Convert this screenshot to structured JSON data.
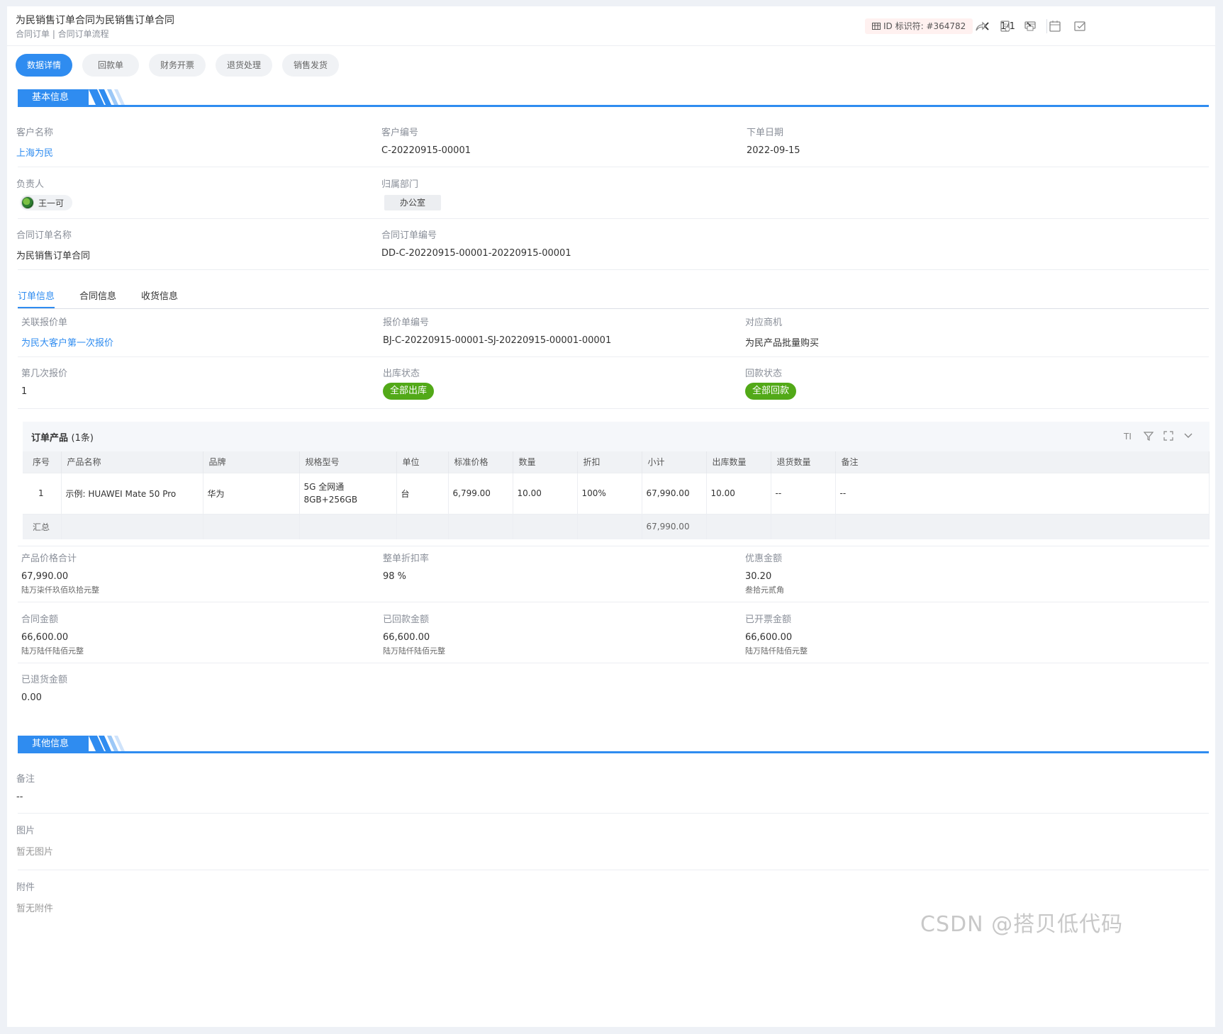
{
  "header": {
    "title": "为民销售订单合同为民销售订单合同",
    "subtitle": "合同订单 | 合同订单流程",
    "id_badge": "ID 标识符: #364782",
    "pager": "1/1"
  },
  "tabs": [
    "数据详情",
    "回款单",
    "财务开票",
    "退货处理",
    "销售发货"
  ],
  "basic": {
    "section_title": "基本信息",
    "customer_name_label": "客户名称",
    "customer_name": "上海为民",
    "customer_no_label": "客户编号",
    "customer_no": "C-20220915-00001",
    "order_date_label": "下单日期",
    "order_date": "2022-09-15",
    "owner_label": "负责人",
    "owner": "王一可",
    "dept_label": "归属部门",
    "dept": "办公室",
    "contract_name_label": "合同订单名称",
    "contract_name": "为民销售订单合同",
    "contract_no_label": "合同订单编号",
    "contract_no": "DD-C-20220915-00001-20220915-00001"
  },
  "subtabs": [
    "订单信息",
    "合同信息",
    "收货信息"
  ],
  "order": {
    "quote_label": "关联报价单",
    "quote": "为民大客户第一次报价",
    "quote_no_label": "报价单编号",
    "quote_no": "BJ-C-20220915-00001-SJ-20220915-00001-00001",
    "opportunity_label": "对应商机",
    "opportunity": "为民产品批量购买",
    "quote_round_label": "第几次报价",
    "quote_round": "1",
    "stock_status_label": "出库状态",
    "stock_status": "全部出库",
    "payment_status_label": "回款状态",
    "payment_status": "全部回款",
    "status_color": "#52a918"
  },
  "products": {
    "title": "订单产品",
    "count": "(1条)",
    "columns": [
      "序号",
      "产品名称",
      "品牌",
      "规格型号",
      "单位",
      "标准价格",
      "数量",
      "折扣",
      "小计",
      "出库数量",
      "退货数量",
      "备注"
    ],
    "rows": [
      [
        "1",
        "示例: HUAWEI Mate 50 Pro",
        "华为",
        "5G 全网通 8GB+256GB",
        "台",
        "6,799.00",
        "10.00",
        "100%",
        "67,990.00",
        "10.00",
        "--",
        "--"
      ]
    ],
    "summary_label": "汇总",
    "summary_subtotal": "67,990.00"
  },
  "amounts": {
    "total_label": "产品价格合计",
    "total": "67,990.00",
    "total_cn": "陆万柒仟玖佰玖拾元整",
    "discount_rate_label": "整单折扣率",
    "discount_rate": "98 %",
    "discount_amount_label": "优惠金额",
    "discount_amount": "30.20",
    "discount_amount_cn": "叁拾元贰角",
    "contract_amount_label": "合同金额",
    "contract_amount": "66,600.00",
    "contract_amount_cn": "陆万陆仟陆佰元整",
    "received_label": "已回款金额",
    "received": "66,600.00",
    "received_cn": "陆万陆仟陆佰元整",
    "invoiced_label": "已开票金额",
    "invoiced": "66,600.00",
    "invoiced_cn": "陆万陆仟陆佰元整",
    "returned_label": "已退货金额",
    "returned": "0.00"
  },
  "other": {
    "section_title": "其他信息",
    "remark_label": "备注",
    "remark": "--",
    "image_label": "图片",
    "image": "暂无图片",
    "attachment_label": "附件",
    "attachment": "暂无附件"
  },
  "watermark": "CSDN @搭贝低代码",
  "colors": {
    "accent": "#2f8cf0",
    "status_green": "#52a918"
  }
}
